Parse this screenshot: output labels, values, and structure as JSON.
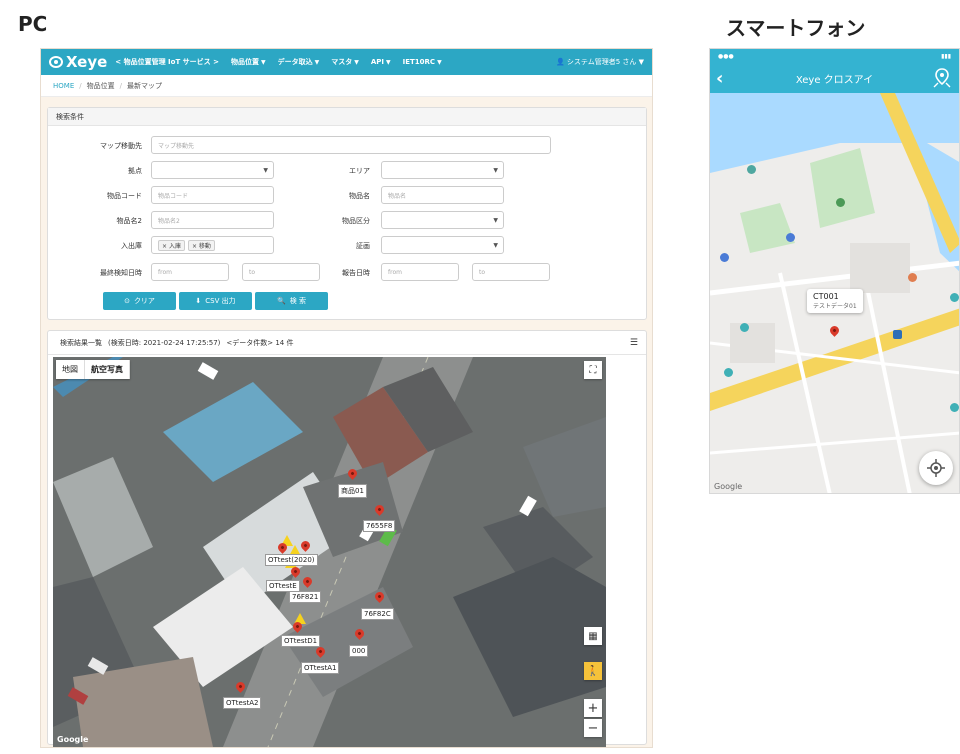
{
  "labels": {
    "pc": "PC",
    "phone": "スマートフォン"
  },
  "navbar": {
    "logo": "Xeye",
    "logo_sub": "クロスアイ",
    "items": [
      "< 物品位置管理 IoT サービス >",
      "物品位置",
      "データ取込",
      "マスタ",
      "API",
      "IET10RC"
    ],
    "user": "システム管理者5 さん"
  },
  "breadcrumb": [
    "HOME",
    "物品位置",
    "最新マップ"
  ],
  "search": {
    "title": "検索条件",
    "map_dest_label": "マップ移動先",
    "map_dest_placeholder": "マップ移動先",
    "base_label": "拠点",
    "area_label": "エリア",
    "code_label": "物品コード",
    "code_placeholder": "物品コード",
    "name_label": "物品名",
    "name_placeholder": "物品名",
    "name2_label": "物品名2",
    "name2_placeholder": "物品名2",
    "category_label": "物品区分",
    "inout_label": "入出庫",
    "inout_tags": [
      "入庫",
      "移動"
    ],
    "device_label": "証画",
    "last_detect_label": "最終検知日時",
    "report_label": "報告日時",
    "from_placeholder": "from",
    "to_placeholder": "to",
    "clear_button": "クリア",
    "csv_button": "CSV 出力",
    "search_button": "検 索"
  },
  "results": {
    "title": "検索結果一覧",
    "search_time": "(検索日時: 2021-02-24 17:25:57)",
    "count": "<データ件数> 14 件"
  },
  "map": {
    "tabs": [
      "地図",
      "航空写真"
    ],
    "google": "Google",
    "markers": [
      "商品01",
      "7655F8",
      "OTtest(2020)",
      "OTtestE",
      "76F821",
      "76F82C",
      "OTtestD1",
      "000",
      "OTtestA1",
      "OTtestA2"
    ]
  },
  "phone": {
    "title": "Xeye クロスアイ",
    "callout": "CT001",
    "callout_sub": "テストデータ01",
    "google": "Google"
  }
}
